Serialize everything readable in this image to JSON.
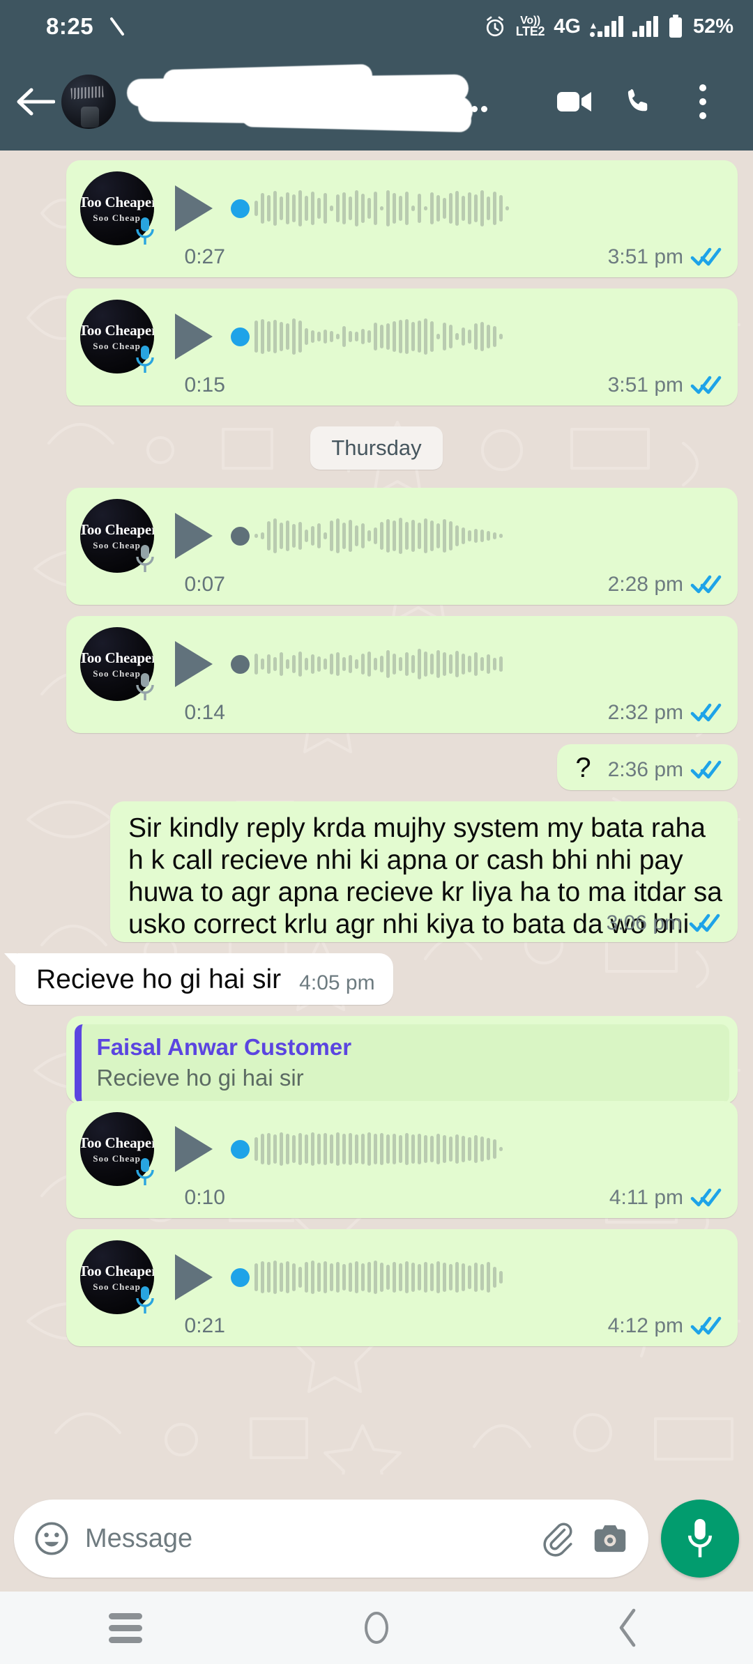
{
  "status_bar": {
    "clock": "8:25",
    "icons": [
      "alarm-clock-icon",
      "volte-icon",
      "signal-icon-sim1",
      "signal-icon-sim2",
      "battery-icon"
    ],
    "network_label": "4G",
    "volte_line1": "Vo))",
    "volte_line2": "LTE2",
    "battery_label": "52%",
    "background_color": "#3e5560"
  },
  "app_bar": {
    "back_label": "Back",
    "contact_name": "",
    "contact_name_redacted": true,
    "avatar_label": "contact avatar",
    "actions": [
      "video-call-icon",
      "voice-call-icon",
      "overflow-menu-icon"
    ],
    "background_color": "#3e5560"
  },
  "chat": {
    "background_color": "#e7ded7",
    "outgoing_bubble_color": "#e3fbd0",
    "incoming_bubble_color": "#ffffff",
    "tick_color": "#1ea3e8",
    "quote_accent_color": "#5b45e0",
    "date_divider": "Thursday",
    "voice_avatar": {
      "line1": "Too Cheaper",
      "line2": "Soo Cheap"
    },
    "messages": [
      {
        "id": "vn1",
        "kind": "voice",
        "direction": "out",
        "duration": "0:27",
        "time": "3:51 pm",
        "status": "read",
        "played": false,
        "dot_color": "#1ea3e8",
        "mic_color": "#29a5e0",
        "wave": [
          22,
          44,
          38,
          50,
          34,
          46,
          40,
          52,
          36,
          48,
          30,
          44,
          8,
          40,
          46,
          34,
          52,
          42,
          30,
          48,
          6,
          52,
          44,
          36,
          48,
          8,
          42,
          6,
          46,
          38,
          30,
          44,
          50,
          36,
          46,
          40,
          52,
          34,
          48,
          38,
          6
        ]
      },
      {
        "id": "vn2",
        "kind": "voice",
        "direction": "out",
        "duration": "0:15",
        "time": "3:51 pm",
        "status": "read",
        "played": false,
        "dot_color": "#1ea3e8",
        "mic_color": "#29a5e0",
        "wave": [
          46,
          50,
          44,
          48,
          42,
          38,
          52,
          46,
          24,
          18,
          14,
          20,
          16,
          8,
          30,
          16,
          14,
          22,
          18,
          40,
          34,
          38,
          44,
          48,
          50,
          42,
          46,
          52,
          44,
          8,
          40,
          34,
          10,
          26,
          20,
          38,
          42,
          34,
          30,
          8
        ]
      },
      {
        "id": "vn3",
        "kind": "voice",
        "direction": "out",
        "duration": "0:07",
        "time": "2:28 pm",
        "status": "read",
        "played": true,
        "dot_color": "#5f7079",
        "mic_color": "#94a3a8",
        "wave": [
          6,
          10,
          42,
          50,
          38,
          44,
          34,
          40,
          18,
          28,
          36,
          10,
          44,
          50,
          38,
          46,
          30,
          36,
          16,
          24,
          40,
          48,
          44,
          52,
          40,
          46,
          38,
          50,
          44,
          36,
          48,
          42,
          30,
          24,
          16,
          20,
          18,
          14,
          10,
          6
        ]
      },
      {
        "id": "vn4",
        "kind": "voice",
        "direction": "out",
        "duration": "0:14",
        "time": "2:32 pm",
        "status": "read",
        "played": true,
        "dot_color": "#5f7079",
        "mic_color": "#94a3a8",
        "wave": [
          30,
          16,
          28,
          20,
          34,
          14,
          26,
          36,
          18,
          28,
          22,
          16,
          30,
          34,
          20,
          26,
          14,
          30,
          36,
          18,
          24,
          40,
          30,
          20,
          34,
          26,
          44,
          36,
          30,
          40,
          34,
          28,
          38,
          30,
          24,
          34,
          20,
          28,
          18,
          22
        ]
      },
      {
        "id": "m5",
        "kind": "text",
        "direction": "out",
        "text": "?",
        "time": "2:36 pm",
        "status": "read",
        "short": true
      },
      {
        "id": "m6",
        "kind": "text",
        "direction": "out",
        "text": "Sir kindly reply krda mujhy system my bata raha h k call recieve nhi ki apna or cash bhi nhi pay huwa to agr apna recieve kr liya ha to ma itdar sa usko correct krlu agr nhi kiya to bata da wo bhi",
        "time": "3:06 pm",
        "status": "read"
      },
      {
        "id": "m7",
        "kind": "text",
        "direction": "in",
        "text": "Recieve ho gi hai sir",
        "time": "4:05 pm",
        "status": "none"
      },
      {
        "id": "m8",
        "kind": "quote",
        "direction": "out",
        "quote_author": "Faisal Anwar Customer",
        "quote_text": "Recieve ho gi hai sir"
      },
      {
        "id": "vn5",
        "kind": "voice",
        "direction": "out",
        "duration": "0:10",
        "time": "4:11 pm",
        "status": "read",
        "played": false,
        "dot_color": "#1ea3e8",
        "mic_color": "#29a5e0",
        "wave": [
          34,
          44,
          46,
          42,
          48,
          44,
          40,
          46,
          42,
          48,
          44,
          46,
          42,
          48,
          44,
          46,
          42,
          44,
          48,
          44,
          46,
          42,
          44,
          40,
          46,
          42,
          44,
          40,
          38,
          44,
          40,
          36,
          42,
          38,
          34,
          40,
          36,
          32,
          28,
          6
        ]
      },
      {
        "id": "vn6",
        "kind": "voice",
        "direction": "out",
        "duration": "0:21",
        "time": "4:12 pm",
        "status": "read",
        "played": false,
        "dot_color": "#1ea3e8",
        "mic_color": "#29a5e0",
        "wave": [
          40,
          46,
          44,
          48,
          42,
          46,
          40,
          30,
          44,
          48,
          42,
          46,
          40,
          44,
          38,
          42,
          46,
          40,
          44,
          48,
          42,
          36,
          44,
          40,
          46,
          42,
          38,
          44,
          40,
          46,
          42,
          38,
          44,
          40,
          34,
          42,
          38,
          44,
          30,
          18
        ]
      }
    ]
  },
  "input_bar": {
    "placeholder": "Message",
    "emoji_icon": "emoji-smiley-icon",
    "attach_icon": "paperclip-icon",
    "camera_icon": "camera-icon",
    "record_icon": "microphone-icon",
    "record_button_color": "#029c6e"
  },
  "nav_bar": {
    "recents_label": "Recents",
    "home_label": "Home",
    "back_label": "Back",
    "background_color": "#f5f7f8"
  }
}
